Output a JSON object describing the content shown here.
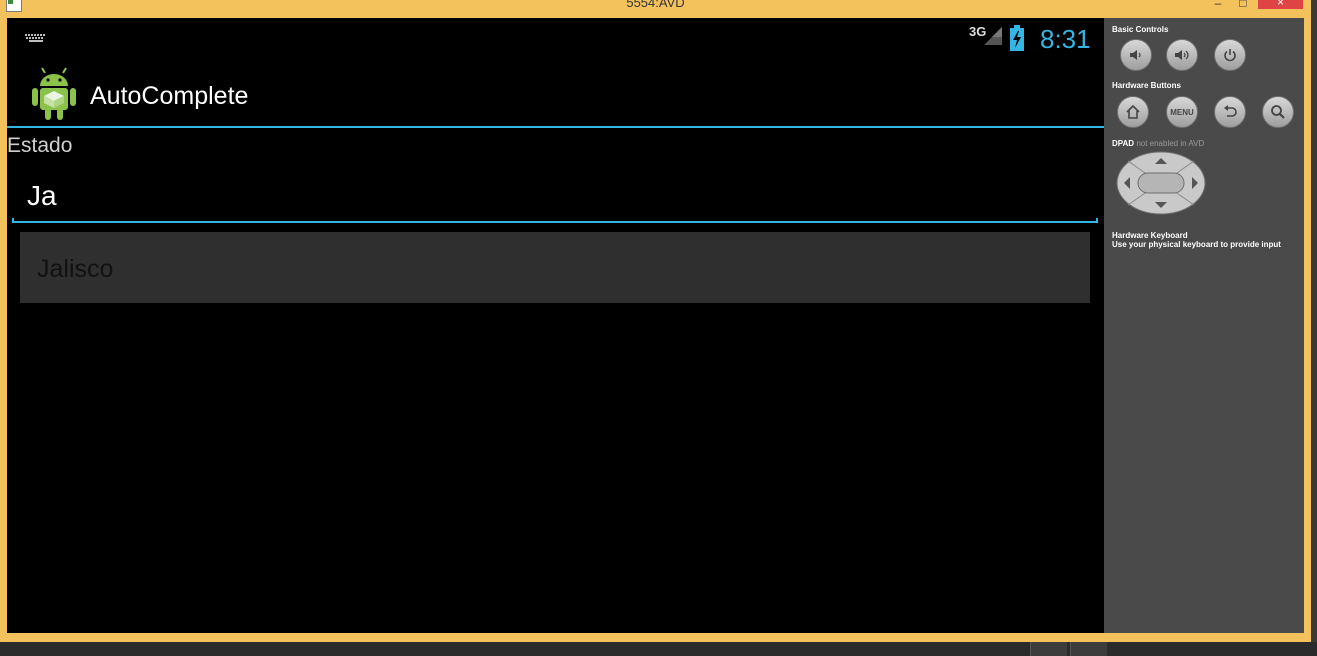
{
  "window": {
    "title": "5554:AVD",
    "minimize_glyph": "–",
    "maximize_glyph": "□",
    "close_glyph": "×"
  },
  "statusbar": {
    "network": "3G",
    "time": "8:31",
    "accent": "#33b5e5",
    "icons": [
      "keyboard-icon",
      "signal-icon",
      "battery-charging-icon"
    ]
  },
  "actionbar": {
    "title": "AutoComplete",
    "icon": "android-app-icon"
  },
  "form": {
    "label": "Estado",
    "input_value": "Ja"
  },
  "suggestions": {
    "items": [
      "Jalisco"
    ]
  },
  "controls": {
    "basic_title": "Basic Controls",
    "hardware_title": "Hardware Buttons",
    "dpad_title": "DPAD",
    "dpad_note": "not enabled in AVD",
    "keyboard_title": "Hardware Keyboard",
    "keyboard_note": "Use your physical keyboard to provide input",
    "menu_label": "MENU",
    "basic_buttons": [
      "volume-down-icon",
      "volume-up-icon",
      "power-icon"
    ],
    "hardware_buttons": [
      "home-icon",
      "menu-icon",
      "back-icon",
      "search-icon"
    ]
  }
}
